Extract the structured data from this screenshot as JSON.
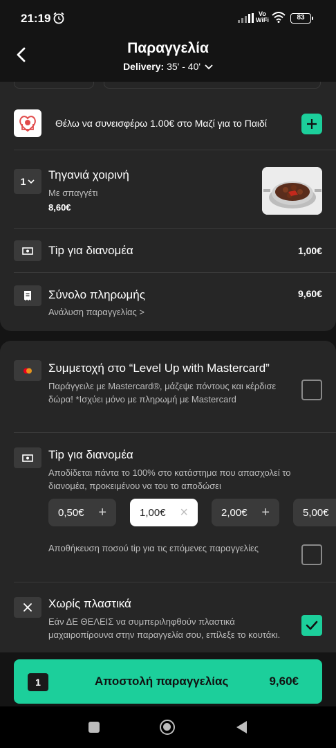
{
  "status_bar": {
    "time": "21:19",
    "network": "Vo\nWiFi",
    "battery": "83"
  },
  "header": {
    "title": "Παραγγελία",
    "delivery_label": "Delivery:",
    "delivery_time": "35' - 40'"
  },
  "donation": {
    "text": "Θέλω να συνεισφέρω 1.00€ στο Μαζί για το Παιδί",
    "icon": "plus-icon"
  },
  "cart_item": {
    "quantity": "1",
    "name": "Τηγανιά χοιρινή",
    "option": "Με σπαγγέτι",
    "price": "8,60€"
  },
  "tip_row": {
    "label": "Tip για διανομέα",
    "value": "1,00€"
  },
  "total_row": {
    "label": "Σύνολο πληρωμής",
    "value": "9,60€",
    "link": "Ανάλυση παραγγελίας >"
  },
  "mastercard": {
    "title": "Συμμετοχή στο “Level Up with Mastercard”",
    "desc": "Παράγγειλε με Mastercard®, μάζεψε πόντους και κέρδισε δώρα! *Ισχύει μόνο με πληρωμή με Mastercard",
    "checked": false
  },
  "tip_section": {
    "title": "Tip για διανομέα",
    "desc": "Αποδίδεται πάντα το 100% στο κατάστημα που απασχολεί το διανομέα, προκειμένου να του το αποδώσει",
    "options": [
      "0,50€",
      "1,00€",
      "2,00€",
      "5,00€"
    ],
    "selected": "1,00€",
    "save_label": "Αποθήκευση ποσού tip για τις επόμενες παραγγελίες",
    "save_checked": false
  },
  "no_plastic": {
    "title": "Χωρίς πλαστικά",
    "desc": "Εάν ΔΕ ΘΕΛΕΙΣ να συμπεριληφθούν πλαστικά μαχαιροπίρουνα στην παραγγελία σου, επίλεξε το κουτάκι.",
    "checked": true
  },
  "cta": {
    "count": "1",
    "label": "Αποστολή παραγγελίας",
    "price": "9,60€"
  },
  "colors": {
    "accent": "#1ccf9b",
    "card": "#262626",
    "background": "#141414"
  }
}
